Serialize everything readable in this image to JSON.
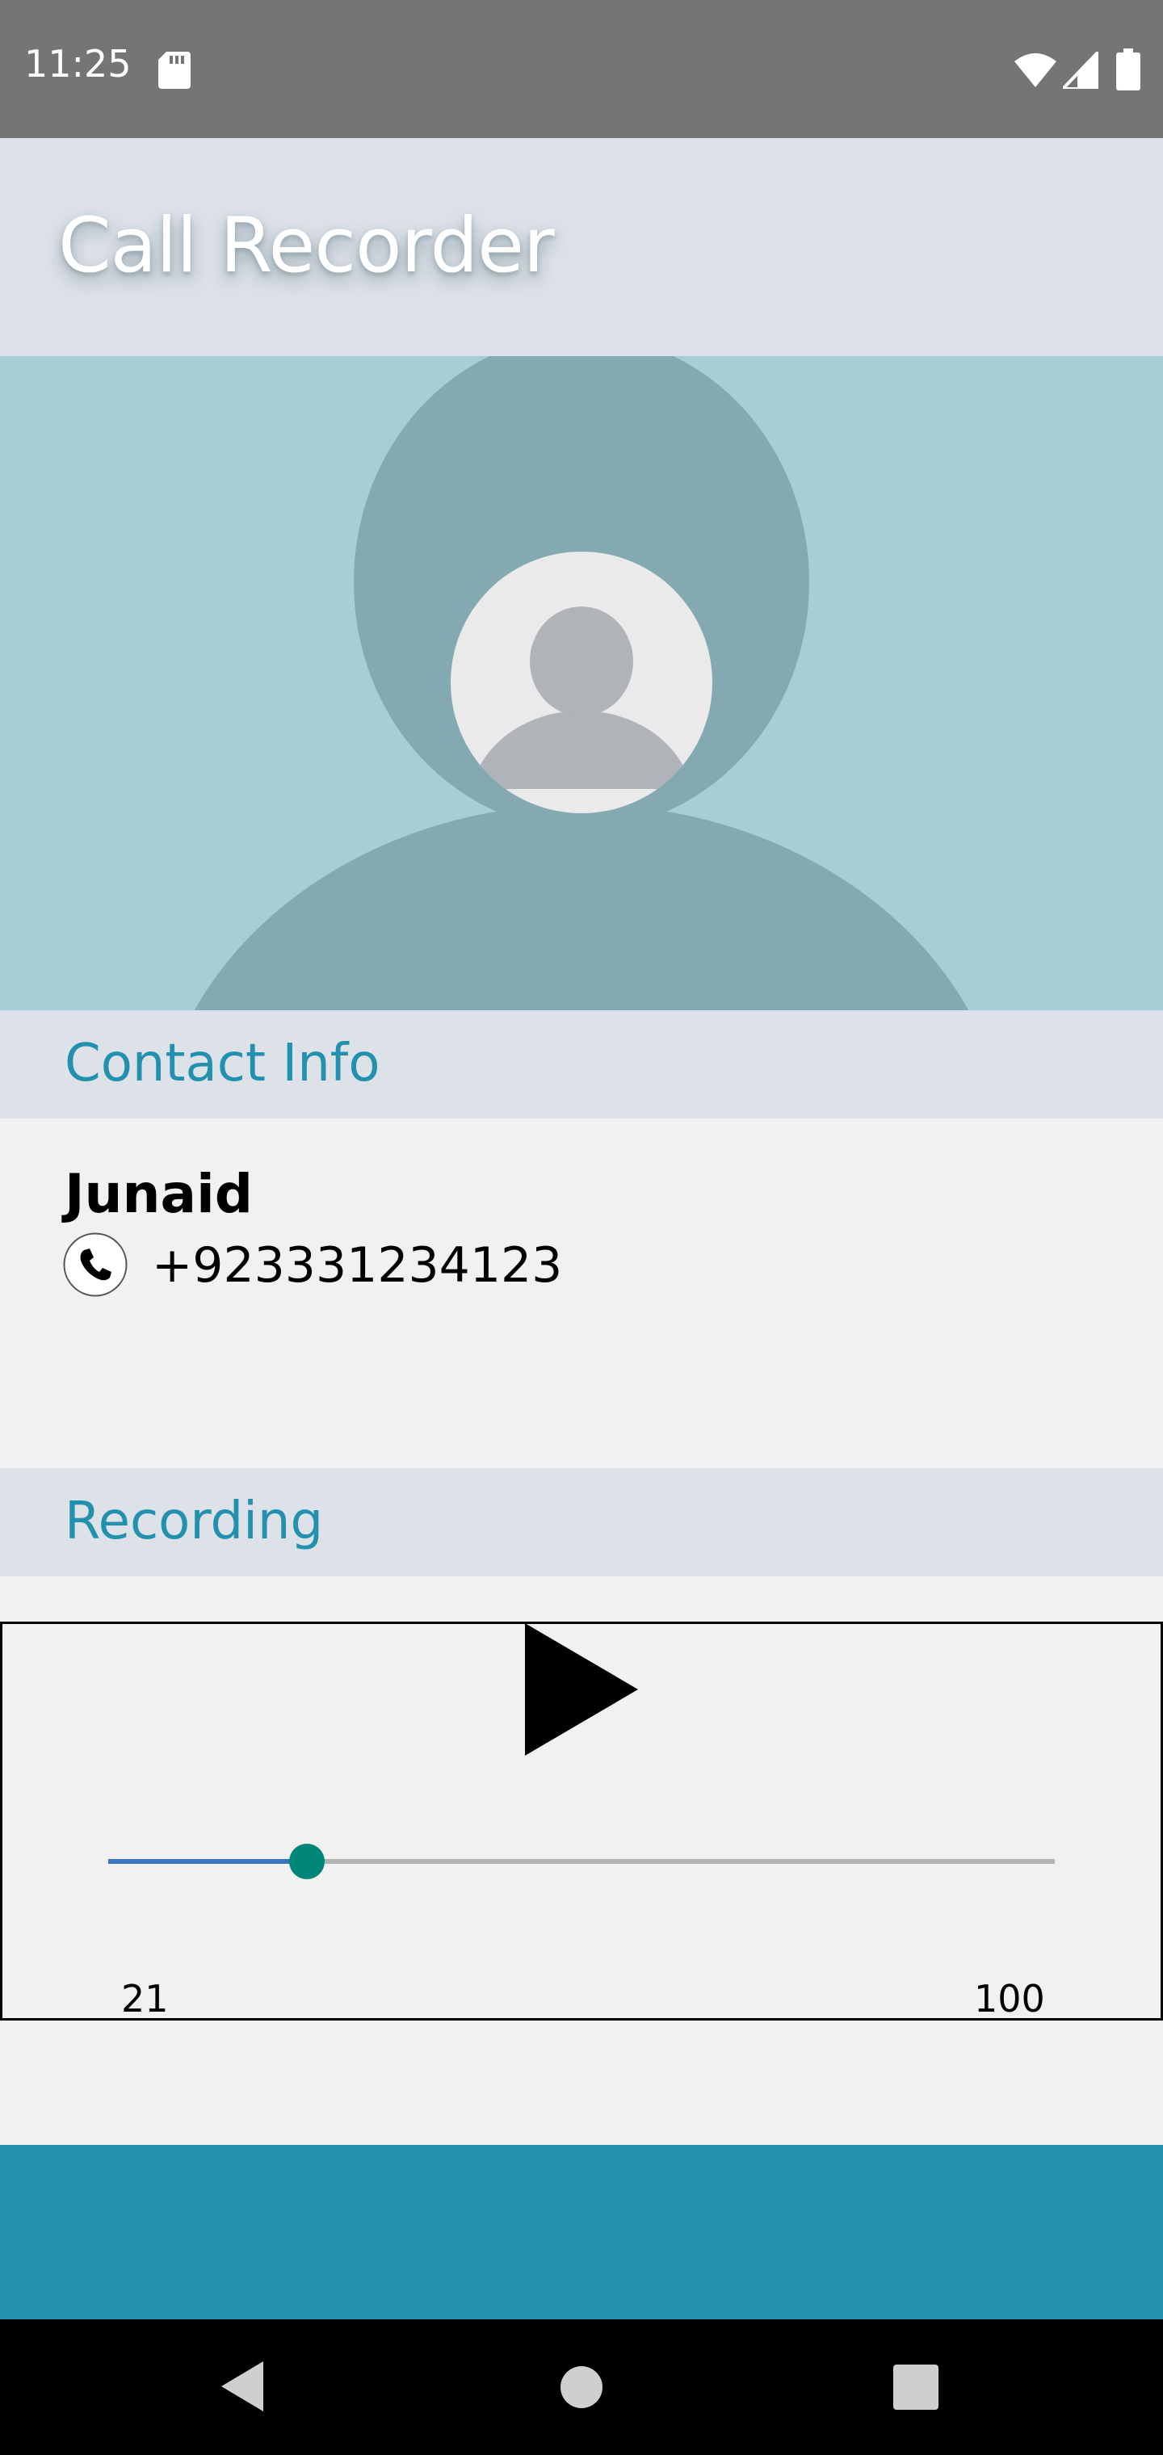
{
  "status_bar": {
    "time": "11:25",
    "icons": [
      "sd-card-icon",
      "wifi-icon",
      "signal-icon",
      "battery-icon"
    ]
  },
  "app": {
    "title": "Call Recorder"
  },
  "contact_info": {
    "section_title": "Contact Info",
    "name": "Junaid",
    "phone": "+923331234123",
    "photo_icon": "default-avatar-icon"
  },
  "recording": {
    "section_title": "Recording",
    "play_icon": "play-icon",
    "progress_current": 21,
    "progress_max": 100,
    "current_label": "21",
    "total_label": "100"
  },
  "navigation": {
    "buttons": [
      "back-icon",
      "home-icon",
      "recents-icon"
    ]
  },
  "colors": {
    "accent": "#2391ad",
    "header_bg": "#dde1e8",
    "banner_bg": "#a9cdd5",
    "seek_progress": "#3b76bd",
    "seek_thumb": "#00877a"
  }
}
